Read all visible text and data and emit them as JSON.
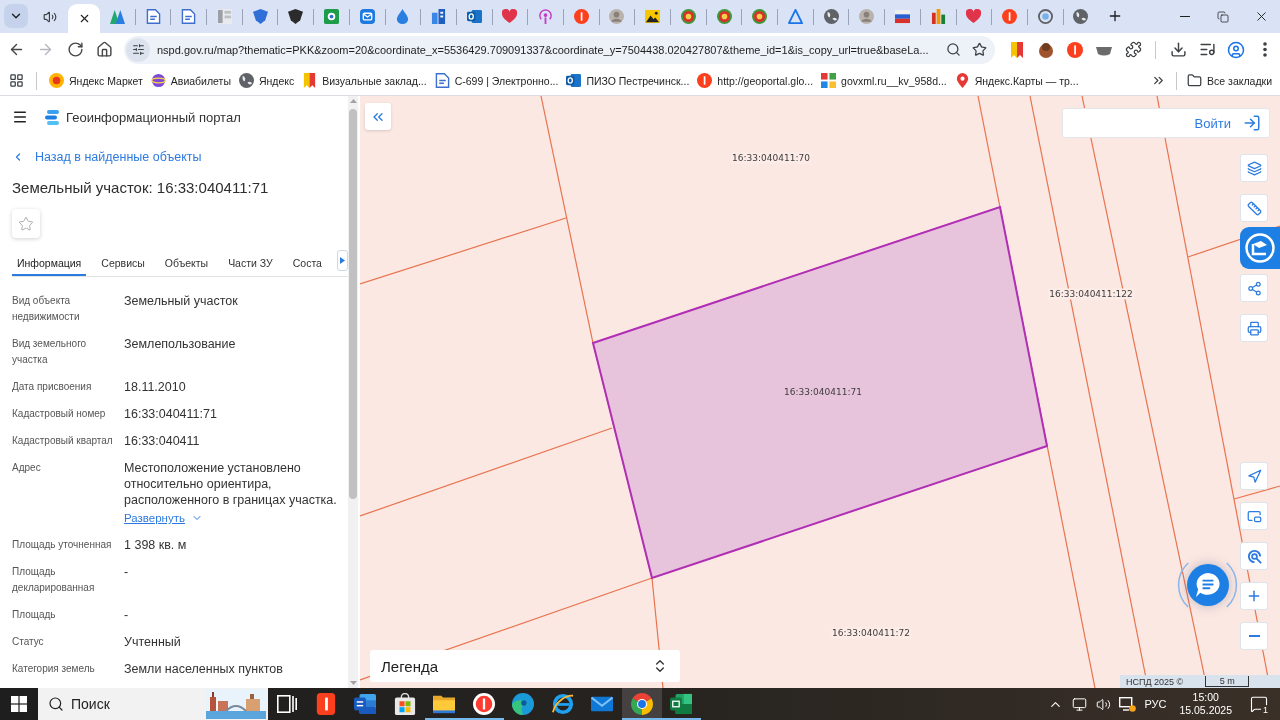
{
  "browser": {
    "tabs": [
      {
        "selected": false,
        "audio": true
      },
      {
        "selected": true,
        "audio": false
      },
      {
        "selected": false,
        "audio": false
      },
      {
        "selected": false,
        "audio": false
      },
      {
        "selected": false,
        "audio": false
      },
      {
        "selected": false,
        "audio": false
      },
      {
        "selected": false,
        "audio": false
      },
      {
        "selected": false,
        "audio": false
      },
      {
        "selected": false,
        "audio": false
      },
      {
        "selected": false,
        "audio": false
      },
      {
        "selected": false,
        "audio": false
      },
      {
        "selected": false,
        "audio": false
      },
      {
        "selected": false,
        "audio": false
      },
      {
        "selected": false,
        "audio": false
      },
      {
        "selected": false,
        "audio": false
      },
      {
        "selected": false,
        "audio": false
      },
      {
        "selected": false,
        "audio": false
      },
      {
        "selected": false,
        "audio": false
      },
      {
        "selected": false,
        "audio": false
      },
      {
        "selected": false,
        "audio": false
      },
      {
        "selected": false,
        "audio": false
      },
      {
        "selected": false,
        "audio": false
      },
      {
        "selected": false,
        "audio": false
      },
      {
        "selected": false,
        "audio": false
      },
      {
        "selected": false,
        "audio": false
      },
      {
        "selected": false,
        "audio": false
      },
      {
        "selected": false,
        "audio": false
      },
      {
        "selected": false,
        "audio": false
      },
      {
        "selected": false,
        "audio": false
      },
      {
        "selected": false,
        "audio": false
      }
    ],
    "nav": [
      {
        "kind": "back",
        "disabled": false
      },
      {
        "kind": "forward",
        "disabled": true
      },
      {
        "kind": "reload",
        "disabled": false
      },
      {
        "kind": "home",
        "disabled": false
      }
    ],
    "url": "nspd.gov.ru/map?thematic=PKK&zoom=20&coordinate_x=5536429.709091337&coordinate_y=7504438.020427807&theme_id=1&is_copy_url=true&baseLa...",
    "bookmarks": [
      "Яндекс Маркет",
      "Авиабилеты",
      "Яндекс",
      "Визуальные заклад...",
      "С-699 | Электронно...",
      "ПИЗО Пестречинск...",
      "http://geoportal.glo...",
      "govxml.ru__kv_958d...",
      "Яндекс.Карты — тр..."
    ],
    "all_bookmarks": "Все закладки"
  },
  "sidebar": {
    "portal_title": "Геоинформационный портал",
    "back_link": "Назад в найденные объекты",
    "title": "Земельный участок: 16:33:040411:71",
    "favorite": false,
    "tabs": [
      {
        "label": "Информация",
        "selected": true
      },
      {
        "label": "Сервисы",
        "selected": false
      },
      {
        "label": "Объекты",
        "selected": false
      },
      {
        "label": "Части ЗУ",
        "selected": false
      },
      {
        "label": "Соста",
        "selected": false
      }
    ],
    "fields": [
      {
        "label": "Вид объекта недвижимости",
        "value": "Земельный участок"
      },
      {
        "label": "Вид земельного участка",
        "value": "Землепользование"
      },
      {
        "label": "Дата присвоения",
        "value": "18.11.2010"
      },
      {
        "label": "Кадастровый номер",
        "value": "16:33:040411:71"
      },
      {
        "label": "Кадастровый квартал",
        "value": "16:33:040411"
      },
      {
        "label": "Адрес",
        "value": "Местоположение установлено относительно ориентира, расположенного в границах участка.",
        "link": "Развернуть"
      },
      {
        "label": "Площадь уточненная",
        "value": "1 398 кв. м"
      },
      {
        "label": "Площадь декларированная",
        "value": "-"
      },
      {
        "label": "Площадь",
        "value": "-"
      },
      {
        "label": "Статус",
        "value": "Учтенный"
      },
      {
        "label": "Категория земель",
        "value": "Земли населенных пунктов"
      }
    ]
  },
  "map": {
    "login": "Войти",
    "parcels": [
      {
        "label": "16:33:040411:70",
        "selected": false
      },
      {
        "label": "16:33:040411:122",
        "selected": false
      },
      {
        "label": "16:33:040411:71",
        "selected": true
      },
      {
        "label": "16:33:040411:72",
        "selected": false
      }
    ],
    "legend": "Легенда",
    "attribution": "НСПД 2025 ©",
    "scale": "5 m"
  },
  "taskbar": {
    "search": {
      "placeholder": "Поиск"
    },
    "apps": [
      {
        "running": false,
        "selected": false
      },
      {
        "running": false,
        "selected": false
      },
      {
        "running": false,
        "selected": false
      },
      {
        "running": true,
        "selected": false
      },
      {
        "running": true,
        "selected": false
      },
      {
        "running": false,
        "selected": false
      },
      {
        "running": false,
        "selected": false
      },
      {
        "running": false,
        "selected": false
      },
      {
        "running": true,
        "selected": true
      },
      {
        "running": true,
        "selected": false
      }
    ],
    "language": "РУС",
    "time": "15:00",
    "date": "15.05.2025",
    "notifications": "1"
  }
}
